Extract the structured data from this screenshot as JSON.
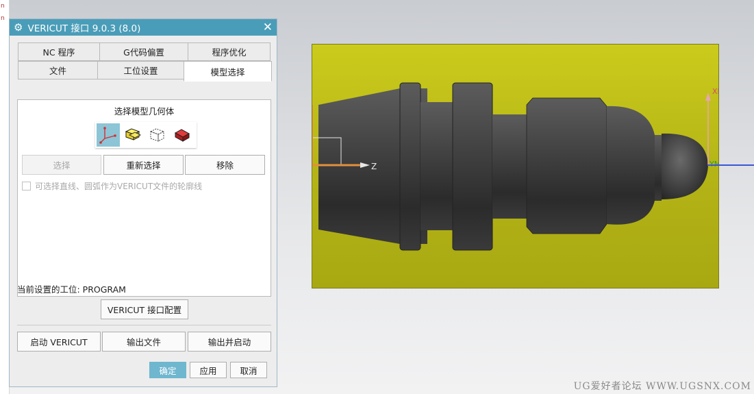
{
  "background_app": {
    "left_strip_chars": [
      "n",
      "n"
    ],
    "viewport": {
      "background_color": "#bcbc18",
      "axis_labels": {
        "z": "Z",
        "xm": "XM",
        "ym": "YM"
      }
    },
    "watermark": "UG爱好者论坛 WWW.UGSNX.COM"
  },
  "dialog": {
    "title": "VERICUT 接口 9.0.3 (8.0)",
    "title_icon": "gear-icon",
    "close_icon": "close-icon",
    "accent_color": "#4a9db8",
    "tabs_row1": [
      "NC 程序",
      "G代码偏置",
      "程序优化"
    ],
    "tabs_row2": [
      "文件",
      "工位设置",
      "模型选择"
    ],
    "active_tab": "模型选择",
    "panel": {
      "section_label": "选择模型几何体",
      "icons": [
        "csys-icon",
        "stock-icon",
        "fixture-icon",
        "design-icon"
      ],
      "buttons": {
        "select": "选择",
        "reselect": "重新选择",
        "remove": "移除"
      },
      "checkbox_label": "可选择直线、圆弧作为VERICUT文件的轮廓线",
      "checkbox_checked": false
    },
    "current_wcs": "当前设置的工位: PROGRAM",
    "config_button": "VERICUT 接口配置",
    "actions": {
      "launch": "启动 VERICUT",
      "export": "输出文件",
      "export_launch": "输出并启动"
    },
    "footer": {
      "ok": "确定",
      "apply": "应用",
      "cancel": "取消"
    }
  }
}
